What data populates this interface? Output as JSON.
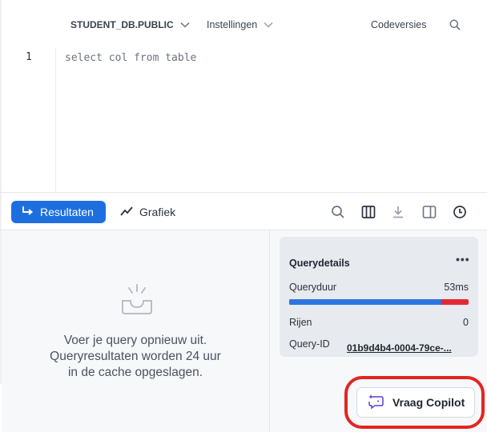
{
  "toolbar": {
    "database": "STUDENT_DB.PUBLIC",
    "settings": "Instellingen",
    "versions": "Codeversies"
  },
  "editor": {
    "line_number": "1",
    "code": "select col from table"
  },
  "results_bar": {
    "tab_results": "Resultaten",
    "tab_chart": "Grafiek",
    "accent_color": "#1d6fe0"
  },
  "empty_state": {
    "line1": "Voer je query opnieuw uit.",
    "line2": "Queryresultaten worden 24 uur",
    "line3": "in de cache opgeslagen."
  },
  "query_details": {
    "title": "Querydetails",
    "duration_label": "Queryduur",
    "duration_value": "53ms",
    "duration_bar_fraction": 0.85,
    "rows_label": "Rijen",
    "rows_value": "0",
    "query_id_label": "Query-ID",
    "query_id_value": "01b9d4b4-0004-79ce-..."
  },
  "copilot": {
    "label": "Vraag Copilot",
    "highlight_color": "#e32520"
  }
}
